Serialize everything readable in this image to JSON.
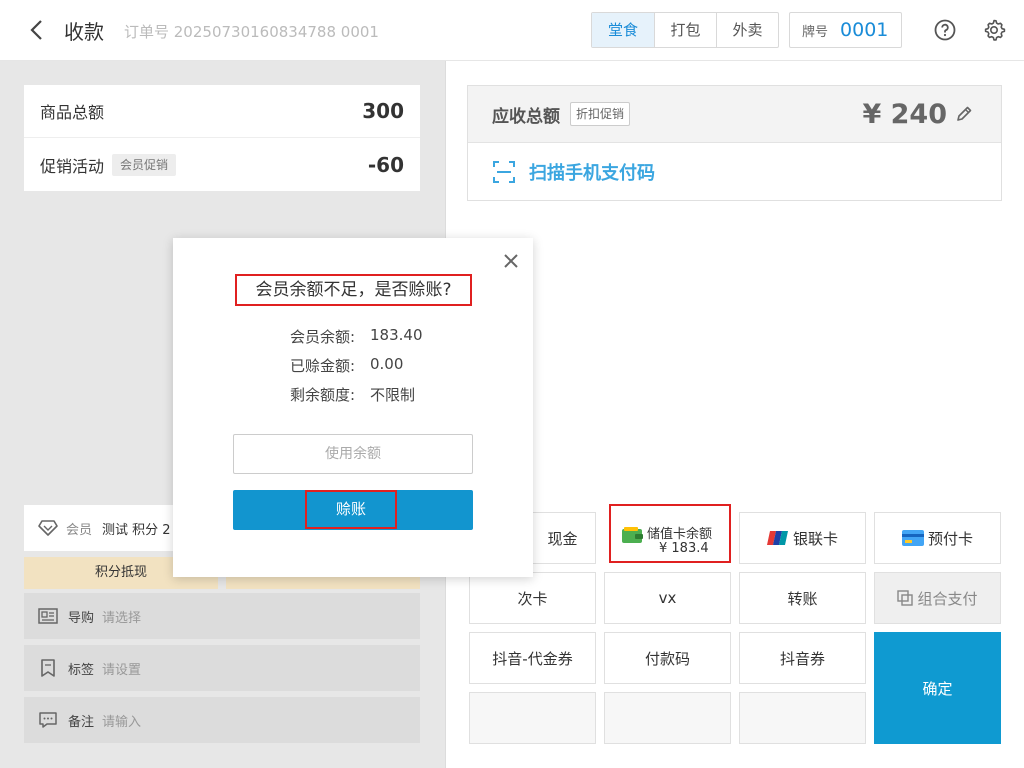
{
  "header": {
    "title": "收款",
    "order": "订单号 20250730160834788 0001",
    "tabs": [
      "堂食",
      "打包",
      "外卖"
    ],
    "plate_label": "牌号",
    "plate_number": "0001"
  },
  "summary": {
    "total_label": "商品总额",
    "total_value": "300",
    "promo_label": "促销活动",
    "promo_tag": "会员促销",
    "promo_value": "-60"
  },
  "member": {
    "label": "会员",
    "info": "测试 积分 2",
    "points_button": "积分抵现"
  },
  "options": [
    {
      "label": "导购",
      "value": "请选择"
    },
    {
      "label": "标签",
      "value": "请设置"
    },
    {
      "label": "备注",
      "value": "请输入"
    }
  ],
  "due": {
    "label": "应收总额",
    "tag": "折扣促销",
    "amount": "¥ 240",
    "scan_label": "扫描手机支付码"
  },
  "pay": {
    "cash": "现金",
    "stored_label": "储值卡余额",
    "stored_amount": "¥ 183.4",
    "unionpay": "银联卡",
    "prepaid": "预付卡",
    "times_card": "次卡",
    "vx": "vx",
    "transfer": "转账",
    "combo": "组合支付",
    "douyin_voucher": "抖音-代金券",
    "pay_code": "付款码",
    "douyin_coupon": "抖音券",
    "confirm": "确定"
  },
  "dialog": {
    "title": "会员余额不足，是否赊账?",
    "rows": [
      {
        "label": "会员余额:",
        "value": "183.40"
      },
      {
        "label": "已赊金额:",
        "value": "0.00"
      },
      {
        "label": "剩余额度:",
        "value": "不限制"
      }
    ],
    "input_placeholder": "使用余额",
    "button": "赊账"
  },
  "colors": {
    "accent": "#0f9ad1",
    "highlight": "#e02020",
    "points_bg": "#f2e2c1"
  }
}
